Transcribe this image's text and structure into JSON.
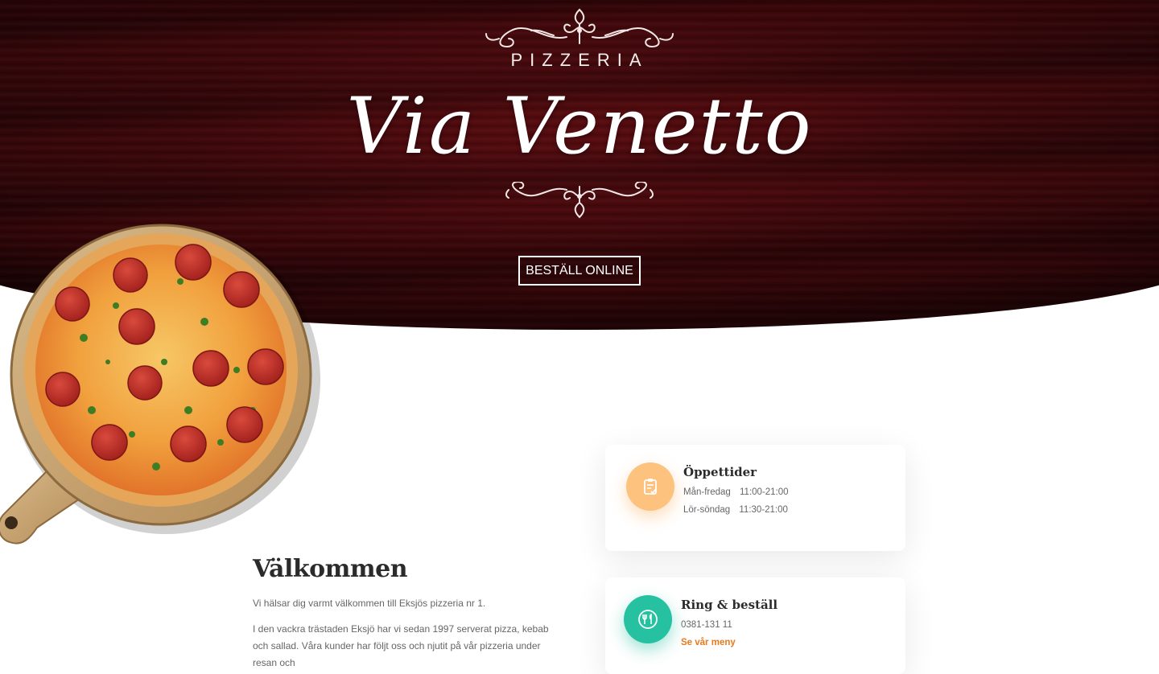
{
  "hero": {
    "kicker": "PIZZERIA",
    "brand_name": "Via Venetto",
    "order_button": "BESTÄLL ONLINE"
  },
  "welcome": {
    "title": "Välkommen",
    "paragraph_1": "Vi hälsar dig varmt välkommen till Eksjös pizzeria nr 1.",
    "paragraph_2": "I den vackra trästaden Eksjö har vi sedan 1997 serverat pizza, kebab och sallad. Våra kunder har följt oss och njutit på vår pizzeria under resan och"
  },
  "hours_card": {
    "title": "Öppettider",
    "rows": [
      {
        "days": "Mån-fredag",
        "time": "11:00-21:00"
      },
      {
        "days": "Lör-söndag",
        "time": "11:30-21:00"
      }
    ],
    "icon": "clipboard-icon",
    "icon_color": "#fcc27e"
  },
  "order_card": {
    "title": "Ring & beställ",
    "phone": "0381-131 11",
    "link": "Se vår meny",
    "icon": "cutlery-icon",
    "icon_color": "#25c1a0",
    "link_color": "#e87a1d"
  },
  "colors": {
    "hero_dark": "#3a070a",
    "text_dark": "#2b2b2b",
    "text_muted": "#666666"
  }
}
